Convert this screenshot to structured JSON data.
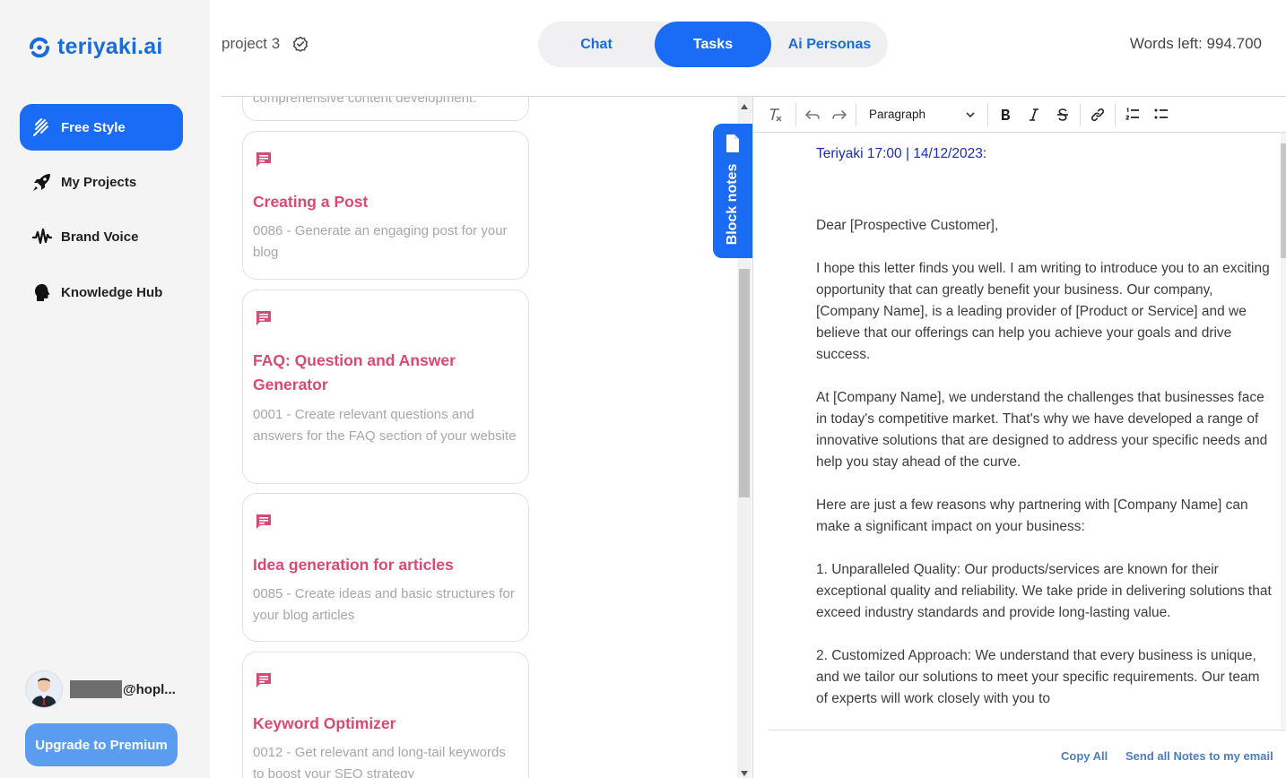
{
  "brand": {
    "name": "teriyaki.ai",
    "color": "#1a6bdc"
  },
  "sidebar": {
    "items": [
      {
        "label": "Free Style",
        "icon": "freestyle-icon",
        "active": true
      },
      {
        "label": "My Projects",
        "icon": "rocket-icon",
        "active": false
      },
      {
        "label": "Brand Voice",
        "icon": "soundwave-icon",
        "active": false
      },
      {
        "label": "Knowledge Hub",
        "icon": "head-icon",
        "active": false
      }
    ],
    "user": {
      "email_visible": "@hopl..."
    },
    "upgrade_label": "Upgrade to Premium"
  },
  "header": {
    "project_name": "project 3",
    "tabs": [
      {
        "label": "Chat",
        "active": false
      },
      {
        "label": "Tasks",
        "active": true
      },
      {
        "label": "Ai Personas",
        "active": false
      }
    ],
    "words_left": "Words left: 994.700"
  },
  "tasks": {
    "partial_top": "comprehensive content development.",
    "cards": [
      {
        "title": "Creating a Post",
        "desc": "0086 - Generate an engaging post for your blog"
      },
      {
        "title": "FAQ: Question and Answer Generator",
        "desc": "0001 - Create relevant questions and answers for the FAQ section of your website"
      },
      {
        "title": "Idea generation for articles",
        "desc": "0085 - Create ideas and basic structures for your blog articles"
      },
      {
        "title": "Keyword Optimizer",
        "desc": "0012 - Get relevant and long-tail keywords to boost your SEO strategy"
      }
    ]
  },
  "blocknotes": {
    "label": "Block notes"
  },
  "editor": {
    "paragraph_select": "Paragraph",
    "header_line": "Teriyaki 17:00 | 14/12/2023:",
    "paragraphs": [
      "Dear [Prospective Customer],",
      "I hope this letter finds you well. I am writing to introduce you to an exciting opportunity that can greatly benefit your business. Our company, [Company Name], is a leading provider of [Product or Service] and we believe that our offerings can help you achieve your goals and drive success.",
      "At [Company Name], we understand the challenges that businesses face in today's competitive market. That's why we have developed a range of innovative solutions that are designed to address your specific needs and help you stay ahead of the curve.",
      "Here are just a few reasons why partnering with [Company Name] can make a significant impact on your business:",
      "1. Unparalleled Quality: Our products/services are known for their exceptional quality and reliability. We take pride in delivering solutions that exceed industry standards and provide long-lasting value.",
      "2. Customized Approach: We understand that every business is unique, and we tailor our solutions to meet your specific requirements. Our team of experts will work closely with you to"
    ],
    "copy_all": "Copy All",
    "send_all": "Send all Notes to my email"
  }
}
